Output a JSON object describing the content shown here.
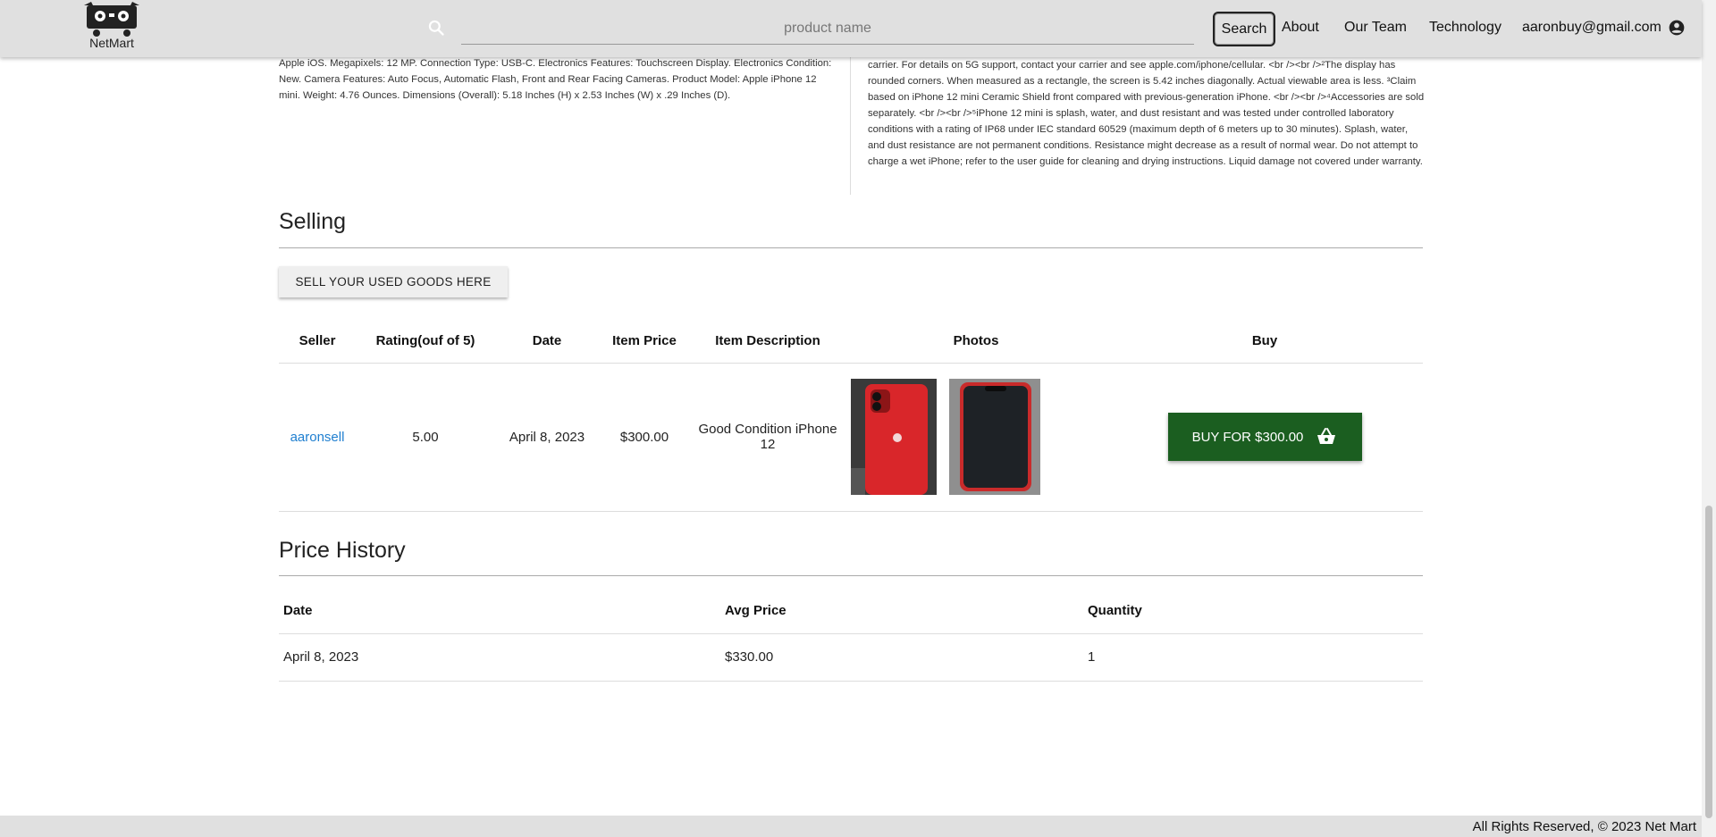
{
  "header": {
    "logo_text": "NetMart",
    "search_placeholder": "product name",
    "search_button": "Search",
    "nav": [
      "About",
      "Our Team",
      "Technology"
    ],
    "user_email": "aaronbuy@gmail.com"
  },
  "description": {
    "left": "Apple iOS. Megapixels: 12 MP. Connection Type: USB-C. Electronics Features: Touchscreen Display. Electronics Condition: New. Camera Features: Auto Focus, Automatic Flash, Front and Rear Facing Cameras. Product Model: Apple iPhone 12 mini. Weight: 4.76 Ounces. Dimensions (Overall): 5.18 Inches (H) x 2.53 Inches (W) x .29 Inches (D).",
    "right": "carrier. For details on 5G support, contact your carrier and see apple.com/iphone/cellular. <br /><br />²The display has rounded corners. When measured as a rectangle, the screen is 5.42 inches diagonally. Actual viewable area is less. ³Claim based on iPhone 12 mini Ceramic Shield front compared with previous-generation iPhone. <br /><br />⁴Accessories are sold separately. <br /><br />⁵iPhone 12 mini is splash, water, and dust resistant and was tested under controlled laboratory conditions with a rating of IP68 under IEC standard 60529 (maximum depth of 6 meters up to 30 minutes). Splash, water, and dust resistance are not permanent conditions. Resistance might decrease as a result of normal wear. Do not attempt to charge a wet iPhone; refer to the user guide for cleaning and drying instructions. Liquid damage not covered under warranty."
  },
  "selling": {
    "title": "Selling",
    "sell_button": "SELL YOUR USED GOODS HERE",
    "columns": [
      "Seller",
      "Rating(ouf of 5)",
      "Date",
      "Item Price",
      "Item Description",
      "Photos",
      "Buy"
    ],
    "rows": [
      {
        "seller": "aaronsell",
        "rating": "5.00",
        "date": "April 8, 2023",
        "price": "$300.00",
        "description": "Good Condition iPhone 12",
        "buy_label": "BUY FOR $300.00"
      }
    ]
  },
  "price_history": {
    "title": "Price History",
    "columns": [
      "Date",
      "Avg Price",
      "Quantity"
    ],
    "rows": [
      {
        "date": "April 8, 2023",
        "avg_price": "$330.00",
        "quantity": "1"
      }
    ]
  },
  "footer": {
    "text": "All Rights Reserved, © 2023 Net Mart"
  },
  "colors": {
    "header_bg": "#e0e0e0",
    "buy_button": "#1b5e20",
    "link": "#1f7fd0"
  },
  "icons": [
    "search-icon",
    "account-circle-icon",
    "shopping-basket-icon",
    "netmart-logo-icon"
  ]
}
